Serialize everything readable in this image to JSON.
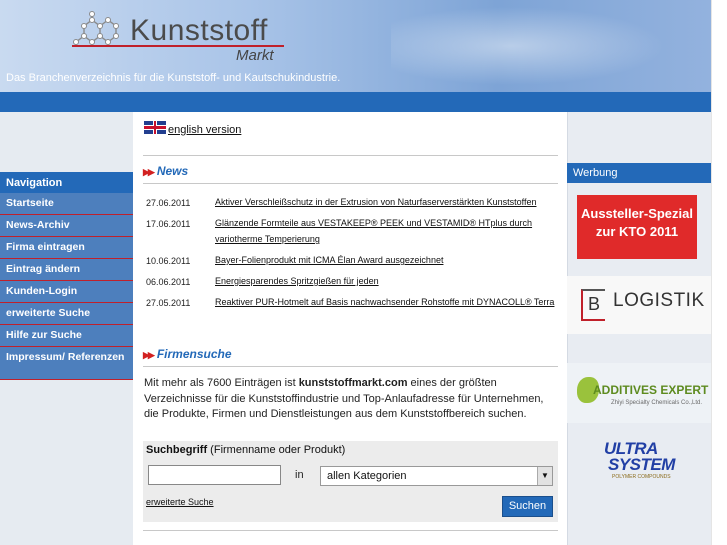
{
  "header": {
    "logo_title": "Kunststoff",
    "logo_subtitle": "Markt",
    "tagline": "Das Branchenverzeichnis für die Kunststoff- und Kautschukindustrie."
  },
  "language_link": "english version",
  "navigation": {
    "heading": "Navigation",
    "items": [
      {
        "label": "Startseite"
      },
      {
        "label": "News-Archiv"
      },
      {
        "label": "Firma eintragen"
      },
      {
        "label": "Eintrag ändern"
      },
      {
        "label": "Kunden-Login"
      },
      {
        "label": "erweiterte Suche"
      },
      {
        "label": "Hilfe zur Suche"
      },
      {
        "label": "Impressum/ Referenzen"
      }
    ]
  },
  "news": {
    "title": "News",
    "items": [
      {
        "date": "27.06.2011",
        "headline": "Aktiver Verschleißschutz in der Extrusion von Naturfaserverstärkten Kunststoffen"
      },
      {
        "date": "17.06.2011",
        "headline": "Glänzende Formteile aus VESTAKEEP® PEEK und VESTAMID® HTplus durch variotherme Temperierung"
      },
      {
        "date": "10.06.2011",
        "headline": "Bayer-Folienprodukt mit ICMA Élan Award ausgezeichnet"
      },
      {
        "date": "06.06.2011",
        "headline": "Energiesparendes Spritzgießen für jeden"
      },
      {
        "date": "27.05.2011",
        "headline": "Reaktiver PUR-Hotmelt auf Basis nachwachsender Rohstoffe mit DYNACOLL® Terra"
      }
    ]
  },
  "firmensuche": {
    "title": "Firmensuche",
    "intro_pre": "Mit mehr als 7600 Einträgen ist ",
    "intro_brand": "kunststoffmarkt.com",
    "intro_post": " eines der größten Verzeichnisse für die Kunststoffindustrie und Top-Anlaufadresse für Unternehmen, die Produkte, Firmen und Dienstleistungen aus dem Kunststoffbereich suchen.",
    "search_label_bold": "Suchbegriff",
    "search_label_rest": " (Firmenname oder Produkt)",
    "search_value": "",
    "in_label": "in",
    "category_selected": "allen Kategorien",
    "advanced_link": "erweiterte Suche",
    "submit_label": "Suchen"
  },
  "werbung": {
    "heading": "Werbung",
    "ads": [
      {
        "text": "Aussteller-Spezial zur KTO 2011"
      },
      {
        "letter": "B",
        "text": "LOGISTIK"
      },
      {
        "text": "ADDITIVES EXPERT",
        "sub": "Zhiyi Specialty Chemicals Co.,Ltd."
      },
      {
        "line1": "ULTRA",
        "line2": "SYSTEM",
        "sub": "POLYMER COMPOUNDS"
      }
    ]
  },
  "colors": {
    "primary_blue": "#2369b8",
    "nav_blue": "#4d7fbd",
    "accent_red": "#c0202a"
  }
}
